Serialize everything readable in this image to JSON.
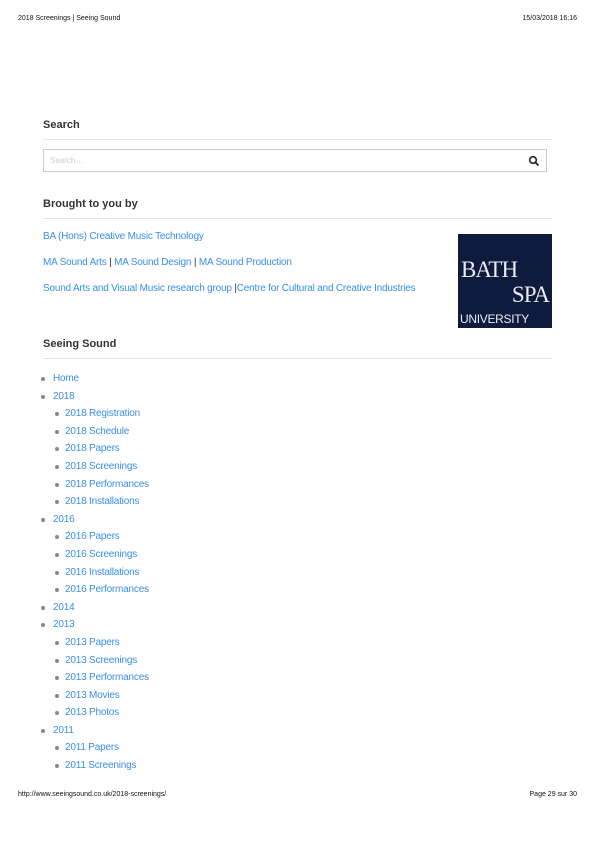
{
  "pdf_header": {
    "title": "2018 Screenings | Seeing Sound",
    "datetime": "15/03/2018 16:16"
  },
  "pdf_footer": {
    "url": "http://www.seeingsound.co.uk/2018-screenings/",
    "page": "Page 29 sur 30"
  },
  "search": {
    "title": "Search",
    "placeholder": "Search…",
    "icon": "search-icon"
  },
  "brought": {
    "title": "Brought to you by",
    "line1": [
      "BA (Hons) Creative Music Technology"
    ],
    "line2": [
      "MA Sound Arts",
      "MA Sound Design",
      "MA Sound Production"
    ],
    "line3": [
      "Sound Arts and Visual Music research group",
      "Centre for Cultural and Creative Industries"
    ],
    "separator": "|",
    "logo": {
      "line1": "BATH",
      "line2": "SPA",
      "line3": "UNIVERSITY",
      "bg": "#0e1b3d"
    }
  },
  "nav": {
    "title": "Seeing Sound",
    "items": [
      {
        "label": "Home",
        "children": []
      },
      {
        "label": "2018",
        "children": [
          "2018 Registration",
          "2018 Schedule",
          "2018 Papers",
          "2018 Screenings",
          "2018 Performances",
          "2018 Installations"
        ]
      },
      {
        "label": "2016",
        "children": [
          "2016 Papers",
          "2016 Screenings",
          "2016 Installations",
          "2016 Performances"
        ]
      },
      {
        "label": "2014",
        "children": []
      },
      {
        "label": "2013",
        "children": [
          "2013 Papers",
          "2013 Screenings",
          "2013 Performances",
          "2013 Movies",
          "2013 Photos"
        ]
      },
      {
        "label": "2011",
        "children": [
          "2011 Papers",
          "2011 Screenings"
        ]
      }
    ]
  },
  "colors": {
    "link": "#3a8ee6",
    "heading": "#333333"
  }
}
